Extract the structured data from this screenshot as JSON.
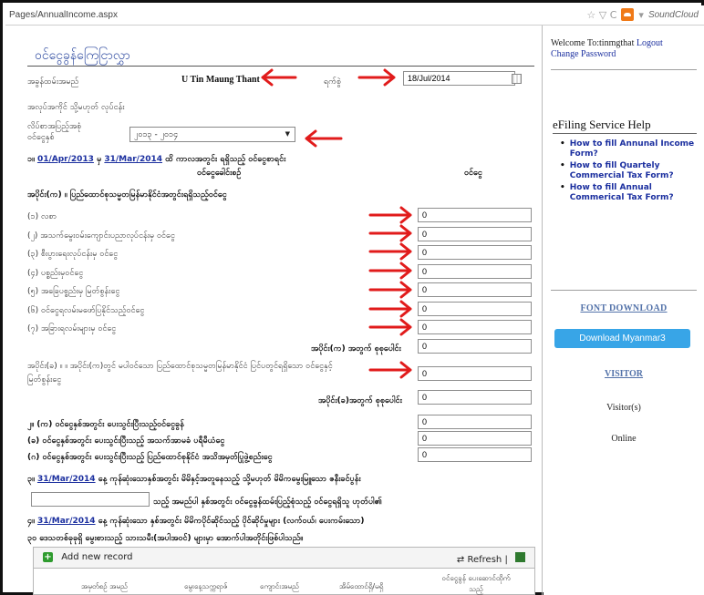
{
  "browser": {
    "url": "Pages/AnnualIncome.aspx",
    "nav_glyphs": "☆ ▽ C",
    "dropdown_glyph": "▾",
    "soundcloud_label": "SoundCloud"
  },
  "form": {
    "title": "ဝင်ငွေခွန်ကြေငြာလွှာ",
    "name_label": "အခွန်ထမ်းအမည်",
    "name_value": "U Tin Maung Thant",
    "date_label": "ရက်စွဲ",
    "date_value": "18/Jul/2014",
    "row2_label": "အလုပ်အကိုင် သို့မဟုတ် လုပ်ငန်း",
    "row3_label": "လိပ်စာအပြည့်အစုံ",
    "year_label": "ဝင်ငွေနှစ်",
    "year_value": "၂၀၁၃ - ၂၀၁၄",
    "period_prefix": "၁။",
    "period_from": "01/Apr/2013",
    "period_mid": "မှ",
    "period_to": "31/Mar/2014",
    "period_suffix": "ထိ ကာလအတွင်း ရရှိသည့် ဝင်ငွေစာရင်း",
    "col_source": "ဝင်ငွေခေါင်းစဉ်",
    "col_amount": "ဝင်ငွေ",
    "section_a_title": "အပိုင်း(က) ။ ပြည်ထောင်စုသမ္မတမြန်မာနိုင်ငံအတွင်းရရှိသည့်ဝင်ငွေ",
    "section_a_items": [
      {
        "label": "(၁) လစာ",
        "value": "0"
      },
      {
        "label": "(၂) အသက်မွေးဝမ်းကျောင်းပညာလုပ်ငန်းမှ ဝင်ငွေ",
        "value": "0"
      },
      {
        "label": "(၃) စီးပွားရေးလုပ်ငန်းမှ ဝင်ငွေ",
        "value": "0"
      },
      {
        "label": "(၄) ပစ္စည်းမှဝင်ငွေ",
        "value": "0"
      },
      {
        "label": "(၅) အခြေပစ္စည်းမှ မြတ်စွန်းငွေ",
        "value": "0"
      },
      {
        "label": "(၆) ဝင်ငွေရလမ်းမဖော်ပြနိုင်သည့်ဝင်ငွေ",
        "value": "0"
      },
      {
        "label": "(၇) အခြားရလမ်းများမှ ဝင်ငွေ",
        "value": "0"
      }
    ],
    "section_a_total_label": "အပိုင်း(က) အတွက် စုစုပေါင်း",
    "section_a_total_value": "0",
    "section_b_line1": "အပိုင်း(ခ) ။ ။ အပိုင်း(က)တွင် မပါဝင်သော ပြည်ထောင်စုသမ္မတမြန်မာနိုင်ငံ ပြင်ပတွင်ရရှိသော ဝင်ငွေနှင့်",
    "section_b_line2": "မြတ်စွန်းငွေ",
    "section_b_value": "0",
    "section_b_total_label": "အပိုင်း(ခ)အတွက် စုစုပေါင်း",
    "section_b_total_value": "0",
    "q2_rows": [
      {
        "label": "၂။ (က) ဝင်ငွေနှစ်အတွင်း ပေးသွင်းပြီးသည့်ဝင်ငွေခွန်",
        "value": "0"
      },
      {
        "label": "(ခ) ဝင်ငွေနှစ်အတွင်း ပေးသွင်းပြီးသည့် အသက်အာမခံ ပရီမီယံငွေ",
        "value": "0"
      },
      {
        "label": "(ဂ) ဝင်ငွေနှစ်အတွင်း ပေးသွင်းပြီးသည့် ပြည်ထောင်စုနိုင်ငံ အသိအမှတ်ပြုဖွဲ့စည်းငွေ",
        "value": "0"
      }
    ],
    "q3_prefix": "၃။",
    "q3_date": "31/Mar/2014",
    "q3_text": "နေ့ ကုန်ဆုံးသောနှစ်အတွင်း မိမိနှင့်အတူနေသည့် သို့မဟုတ် မိမိကမွေးမြူသော ဇနီးခင်ပွန်း",
    "q3b_text": "သည့် အမည်ပါ နှစ်အတွင်း ဝင်ငွေခွန်ထမ်းပြည့်စုံသည့် ဝင်ငွေရရှိသူ ဟုတ်ပါ၏",
    "q4_prefix": "၄။",
    "q4_date": "31/Mar/2014",
    "q4_text": "နေ့ ကုန်ဆုံးသော နှစ်အတွင်း မိမိကပိုင်ဆိုင်သည့် ပိုင်ဆိုင်မှုများ (လက်ဝယ်၊ ပေးကမ်းသော)",
    "q4b_text": "၃၀ ဒေသတစ်ခုခုရှိ မွေးစားသည့် သားသမီး(အပါအဝင်) များမှာ အောက်ပါအတိုင်းဖြစ်ပါသည်။"
  },
  "grid": {
    "add_label": "Add new record",
    "plus_glyph": "+",
    "refresh_label": "Refresh",
    "refresh_glyph": "⇄",
    "separator": "|",
    "columns": [
      "အမှတ်စဉ် အမည်",
      "မွေးနေ့သက္ကရာဇ်",
      "ကျောင်းအမည်",
      "အိမ်ထောင်ရှိ/မရှိ",
      "ဝင်ငွေခွန် ပေးဆောင်ထိုက်သည့်"
    ]
  },
  "sidebar": {
    "welcome_prefix": "Welcome To:",
    "username": "tinmgthat",
    "logout": "Logout",
    "change_password": "Change Password",
    "help_title": "eFiling Service Help",
    "bullet": "•",
    "help_links": [
      "How to fill Annunal Income Form?",
      "How to fill Quartely Commercial Tax Form?",
      "How to fill Annual Commerical Tax Form?"
    ],
    "font_title": "FONT DOWNLOAD",
    "download_button": "Download Myanmar3",
    "visitor_title": "VISITOR",
    "visitor_label": "Visitor(s)",
    "online_label": "Online"
  },
  "colors": {
    "accent": "#2e4aa0",
    "arrow": "#e11b1b",
    "download_button": "#38a5e7"
  }
}
